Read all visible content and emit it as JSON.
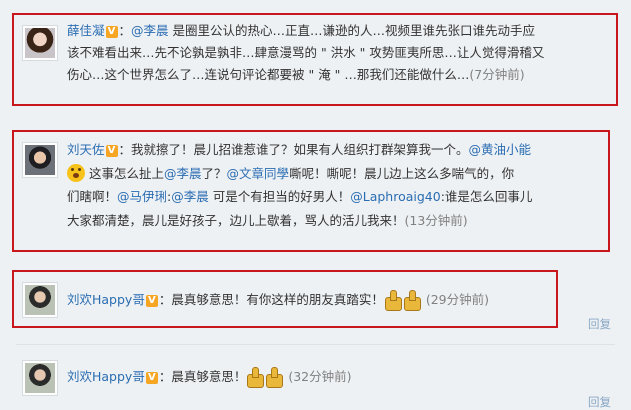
{
  "colors": {
    "highlight_border": "#c8161d",
    "name_link": "#2a6db2",
    "time": "#808080"
  },
  "comments": [
    {
      "name": "薛佳凝",
      "lines": [
        [
          "@李晨",
          " 是圈里公认的热心…正直…谦逊的人…视频里谁先张口谁先动手应"
        ],
        [
          "该不难看出来…先不论孰是孰非…肆意漫骂的 \" 洪水 \" 攻势匪夷所思…让人觉得滑稽又"
        ],
        [
          "伤心…这个世界怎么了…连说句评论都要被 \" 淹 \" …那我们还能做什么…",
          "(7分钟前)"
        ]
      ]
    },
    {
      "name": "刘天佐",
      "line1": [
        "：我就擦了！晨儿招谁惹谁了？如果有人组织打群架算我一个。",
        "@黄油小能"
      ],
      "line2": [
        "这事怎么扯上",
        "@李晨",
        "了？",
        "@文章同學",
        "嘶呢！嘶呢！晨儿边上这么多喘气的，你"
      ],
      "line3": [
        "们瞎啊！",
        "@马伊琍",
        ":",
        "@李晨",
        " 可是个有担当的好男人！",
        "@Laphroaig40",
        ":谁是怎么回事儿"
      ],
      "line4": [
        "大家都清楚，晨儿是好孩子，边儿上歇着，骂人的活儿我来！",
        "(13分钟前)"
      ]
    },
    {
      "name": "刘欢Happy哥",
      "text": "：晨真够意思！有你这样的朋友真踏实！",
      "time": "(29分钟前)"
    },
    {
      "name": "刘欢Happy哥",
      "text": "：晨真够意思！",
      "time": "(32分钟前)"
    }
  ],
  "reply_label": "回复",
  "verified_mark": "V"
}
